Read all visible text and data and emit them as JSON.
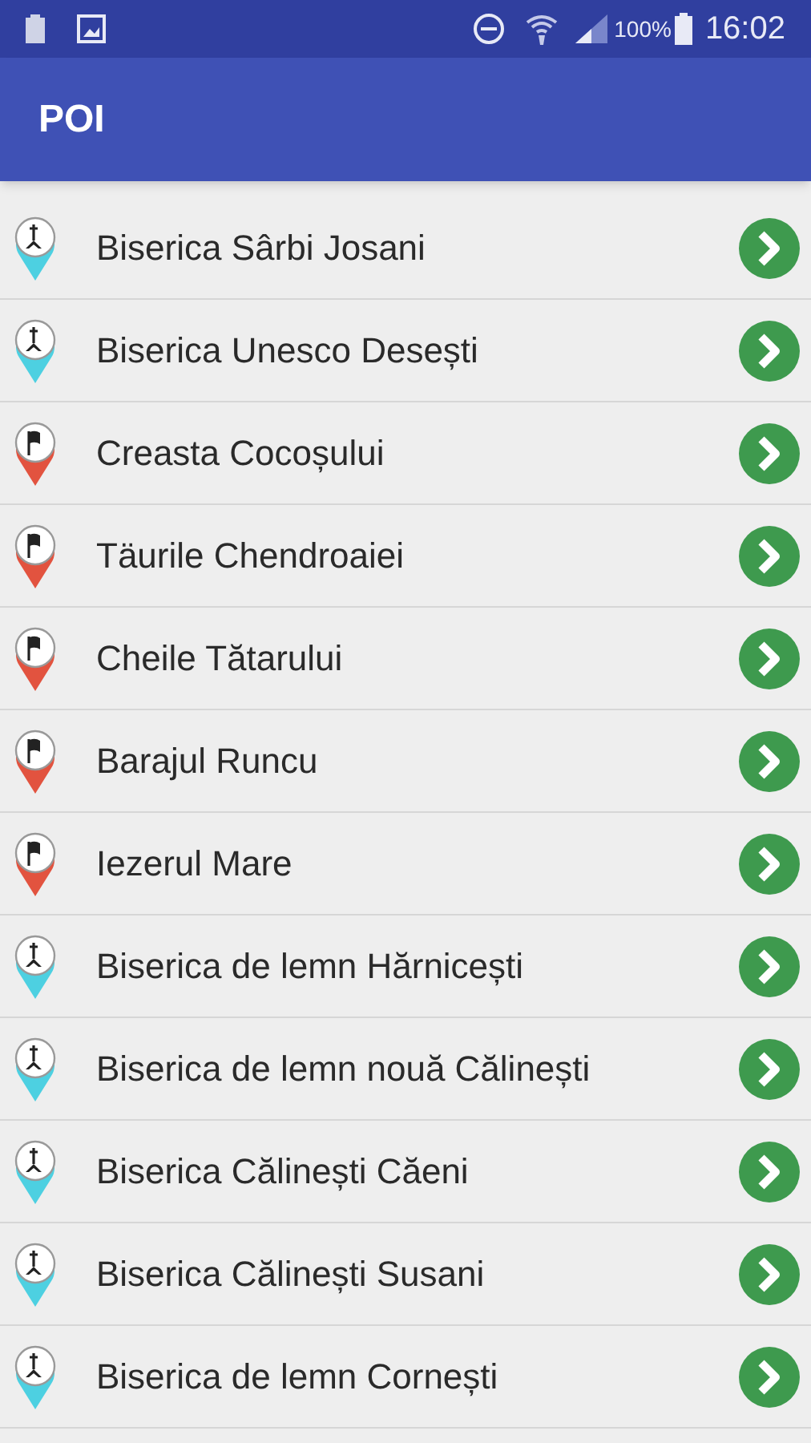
{
  "status_bar": {
    "battery_percent": "100%",
    "time": "16:02"
  },
  "app_bar": {
    "title": "POI"
  },
  "items": [
    {
      "kind": "church",
      "name": "Biserica Sârbi Josani"
    },
    {
      "kind": "church",
      "name": "Biserica Unesco Desești"
    },
    {
      "kind": "flag",
      "name": "Creasta Cocoșului"
    },
    {
      "kind": "flag",
      "name": "Täurile Chendroaiei"
    },
    {
      "kind": "flag",
      "name": "Cheile Tătarului"
    },
    {
      "kind": "flag",
      "name": "Barajul Runcu"
    },
    {
      "kind": "flag",
      "name": "Iezerul Mare"
    },
    {
      "kind": "church",
      "name": "Biserica de lemn Hărnicești"
    },
    {
      "kind": "church",
      "name": "Biserica de lemn nouă Călinești"
    },
    {
      "kind": "church",
      "name": "Biserica Călinești Căeni"
    },
    {
      "kind": "church",
      "name": "Biserica Călinești Susani"
    },
    {
      "kind": "church",
      "name": "Biserica de lemn Cornești"
    }
  ]
}
